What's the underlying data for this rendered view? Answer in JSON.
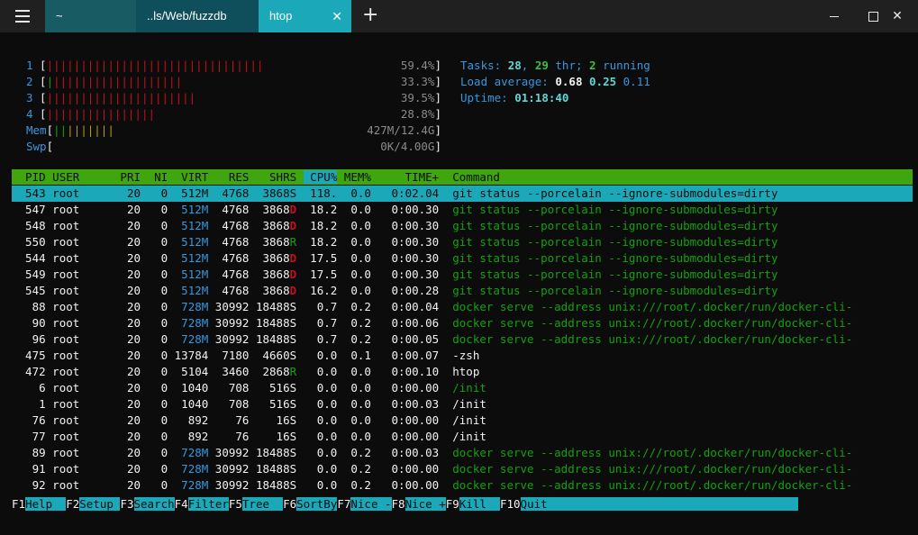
{
  "tabs": [
    {
      "label": "~"
    },
    {
      "label": "..ls/Web/fuzzdb"
    },
    {
      "label": "htop",
      "close": "✕"
    }
  ],
  "new_tab": "+",
  "window_controls": {
    "close": "✕"
  },
  "meters": {
    "cpu": [
      {
        "label": "1",
        "bars": "||||||||||||||||||||||||||||||||",
        "value": "59.4%"
      },
      {
        "label": "2",
        "bars": "|||||||||||||||||||",
        "value": "33.3%"
      },
      {
        "label": "3",
        "bars": "||||||||||||||||||||||",
        "value": "39.5%"
      },
      {
        "label": "4",
        "bars": "||||||||||||||||",
        "value": "28.8%"
      }
    ],
    "mem": {
      "label": "Mem",
      "bars": "|||||||",
      "value": "427M/12.4G"
    },
    "swp": {
      "label": "Swp",
      "bars": "",
      "value": "0K/4.00G"
    }
  },
  "tasks": {
    "label": "Tasks:",
    "count": "28",
    "sep": ",",
    "thr": "29",
    "thr_label": "thr;",
    "running": "2",
    "running_label": "running"
  },
  "load": {
    "label": "Load average:",
    "v1": "0.68",
    "v5": "0.25",
    "v15": "0.11"
  },
  "uptime": {
    "label": "Uptime:",
    "value": "01:18:40"
  },
  "columns": [
    "PID",
    "USER",
    "PRI",
    "NI",
    "VIRT",
    "RES",
    "SHR",
    "S",
    "CPU%",
    "MEM%",
    "TIME+",
    "Command"
  ],
  "processes": [
    {
      "pid": "543",
      "user": "root",
      "pri": "20",
      "ni": "0",
      "virt": "512M",
      "res": "4768",
      "shr": "3868",
      "s": "S",
      "cpu": "118.",
      "mem": "0.0",
      "time": "0:02.04",
      "cmd": "git status --porcelain --ignore-submodules=dirty"
    },
    {
      "pid": "547",
      "user": "root",
      "pri": "20",
      "ni": "0",
      "virt": "512M",
      "res": "4768",
      "shr": "3868",
      "s": "D",
      "cpu": "18.2",
      "mem": "0.0",
      "time": "0:00.30",
      "cmd": "git status --porcelain --ignore-submodules=dirty"
    },
    {
      "pid": "548",
      "user": "root",
      "pri": "20",
      "ni": "0",
      "virt": "512M",
      "res": "4768",
      "shr": "3868",
      "s": "D",
      "cpu": "18.2",
      "mem": "0.0",
      "time": "0:00.30",
      "cmd": "git status --porcelain --ignore-submodules=dirty"
    },
    {
      "pid": "550",
      "user": "root",
      "pri": "20",
      "ni": "0",
      "virt": "512M",
      "res": "4768",
      "shr": "3868",
      "s": "R",
      "cpu": "18.2",
      "mem": "0.0",
      "time": "0:00.30",
      "cmd": "git status --porcelain --ignore-submodules=dirty"
    },
    {
      "pid": "544",
      "user": "root",
      "pri": "20",
      "ni": "0",
      "virt": "512M",
      "res": "4768",
      "shr": "3868",
      "s": "D",
      "cpu": "17.5",
      "mem": "0.0",
      "time": "0:00.30",
      "cmd": "git status --porcelain --ignore-submodules=dirty"
    },
    {
      "pid": "549",
      "user": "root",
      "pri": "20",
      "ni": "0",
      "virt": "512M",
      "res": "4768",
      "shr": "3868",
      "s": "D",
      "cpu": "17.5",
      "mem": "0.0",
      "time": "0:00.30",
      "cmd": "git status --porcelain --ignore-submodules=dirty"
    },
    {
      "pid": "545",
      "user": "root",
      "pri": "20",
      "ni": "0",
      "virt": "512M",
      "res": "4768",
      "shr": "3868",
      "s": "D",
      "cpu": "16.2",
      "mem": "0.0",
      "time": "0:00.28",
      "cmd": "git status --porcelain --ignore-submodules=dirty"
    },
    {
      "pid": "88",
      "user": "root",
      "pri": "20",
      "ni": "0",
      "virt": "728M",
      "res": "30992",
      "shr": "18488",
      "s": "S",
      "cpu": "0.7",
      "mem": "0.2",
      "time": "0:00.04",
      "cmd": "docker serve --address unix:///root/.docker/run/docker-cli-"
    },
    {
      "pid": "90",
      "user": "root",
      "pri": "20",
      "ni": "0",
      "virt": "728M",
      "res": "30992",
      "shr": "18488",
      "s": "S",
      "cpu": "0.7",
      "mem": "0.2",
      "time": "0:00.06",
      "cmd": "docker serve --address unix:///root/.docker/run/docker-cli-"
    },
    {
      "pid": "96",
      "user": "root",
      "pri": "20",
      "ni": "0",
      "virt": "728M",
      "res": "30992",
      "shr": "18488",
      "s": "S",
      "cpu": "0.7",
      "mem": "0.2",
      "time": "0:00.05",
      "cmd": "docker serve --address unix:///root/.docker/run/docker-cli-"
    },
    {
      "pid": "475",
      "user": "root",
      "pri": "20",
      "ni": "0",
      "virt": "13784",
      "res": "7180",
      "shr": "4660",
      "s": "S",
      "cpu": "0.0",
      "mem": "0.1",
      "time": "0:00.07",
      "cmd": "-zsh"
    },
    {
      "pid": "472",
      "user": "root",
      "pri": "20",
      "ni": "0",
      "virt": "5104",
      "res": "3460",
      "shr": "2868",
      "s": "R",
      "cpu": "0.0",
      "mem": "0.0",
      "time": "0:00.10",
      "cmd": "htop"
    },
    {
      "pid": "6",
      "user": "root",
      "pri": "20",
      "ni": "0",
      "virt": "1040",
      "res": "708",
      "shr": "516",
      "s": "S",
      "cpu": "0.0",
      "mem": "0.0",
      "time": "0:00.00",
      "cmd": "/init"
    },
    {
      "pid": "1",
      "user": "root",
      "pri": "20",
      "ni": "0",
      "virt": "1040",
      "res": "708",
      "shr": "516",
      "s": "S",
      "cpu": "0.0",
      "mem": "0.0",
      "time": "0:00.03",
      "cmd": "/init"
    },
    {
      "pid": "76",
      "user": "root",
      "pri": "20",
      "ni": "0",
      "virt": "892",
      "res": "76",
      "shr": "16",
      "s": "S",
      "cpu": "0.0",
      "mem": "0.0",
      "time": "0:00.00",
      "cmd": "/init"
    },
    {
      "pid": "77",
      "user": "root",
      "pri": "20",
      "ni": "0",
      "virt": "892",
      "res": "76",
      "shr": "16",
      "s": "S",
      "cpu": "0.0",
      "mem": "0.0",
      "time": "0:00.00",
      "cmd": "/init"
    },
    {
      "pid": "89",
      "user": "root",
      "pri": "20",
      "ni": "0",
      "virt": "728M",
      "res": "30992",
      "shr": "18488",
      "s": "S",
      "cpu": "0.0",
      "mem": "0.2",
      "time": "0:00.03",
      "cmd": "docker serve --address unix:///root/.docker/run/docker-cli-"
    },
    {
      "pid": "91",
      "user": "root",
      "pri": "20",
      "ni": "0",
      "virt": "728M",
      "res": "30992",
      "shr": "18488",
      "s": "S",
      "cpu": "0.0",
      "mem": "0.2",
      "time": "0:00.00",
      "cmd": "docker serve --address unix:///root/.docker/run/docker-cli-"
    },
    {
      "pid": "92",
      "user": "root",
      "pri": "20",
      "ni": "0",
      "virt": "728M",
      "res": "30992",
      "shr": "18488",
      "s": "S",
      "cpu": "0.0",
      "mem": "0.2",
      "time": "0:00.00",
      "cmd": "docker serve --address unix:///root/.docker/run/docker-cli-"
    }
  ],
  "footer": [
    {
      "key": "F1",
      "label": "Help  "
    },
    {
      "key": "F2",
      "label": "Setup "
    },
    {
      "key": "F3",
      "label": "Search"
    },
    {
      "key": "F4",
      "label": "Filter"
    },
    {
      "key": "F5",
      "label": "Tree  "
    },
    {
      "key": "F6",
      "label": "SortBy"
    },
    {
      "key": "F7",
      "label": "Nice -"
    },
    {
      "key": "F8",
      "label": "Nice +"
    },
    {
      "key": "F9",
      "label": "Kill  "
    },
    {
      "key": "F10",
      "label": "Quit                                     "
    }
  ],
  "colors": {
    "accent": "#1ba9b9",
    "header": "#3fa60f",
    "cpu_bar": "#c50f1f",
    "bg": "#0c0c0c"
  }
}
